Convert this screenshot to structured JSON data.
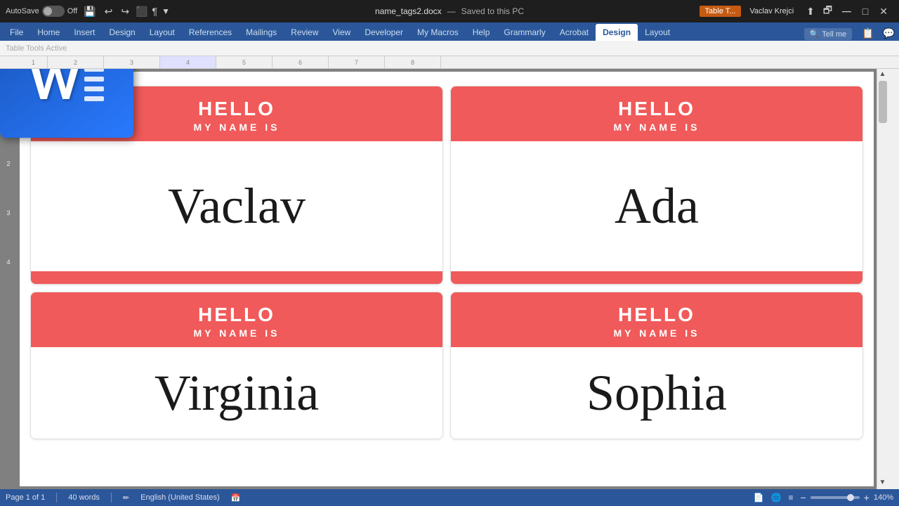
{
  "titlebar": {
    "autosave_label": "AutoSave",
    "autosave_state": "Off",
    "filename": "name_tags2.docx",
    "saved_state": "Saved to this PC",
    "context_tab": "Table T...",
    "username": "Vaclav Krejci",
    "tell_me": "Tell me"
  },
  "tabs": [
    {
      "label": "File",
      "active": false
    },
    {
      "label": "Home",
      "active": false
    },
    {
      "label": "Insert",
      "active": false
    },
    {
      "label": "Design",
      "active": false
    },
    {
      "label": "Layout",
      "active": false
    },
    {
      "label": "References",
      "active": false
    },
    {
      "label": "Mailings",
      "active": false
    },
    {
      "label": "Review",
      "active": false
    },
    {
      "label": "View",
      "active": false
    },
    {
      "label": "Developer",
      "active": false
    },
    {
      "label": "My Macros",
      "active": false
    },
    {
      "label": "Help",
      "active": false
    },
    {
      "label": "Grammarly",
      "active": false
    },
    {
      "label": "Acrobat",
      "active": false
    },
    {
      "label": "Design",
      "active": true,
      "context": false
    },
    {
      "label": "Layout",
      "active": false,
      "context": false
    }
  ],
  "nametags": [
    {
      "hello": "HELLO",
      "subtitle": "MY NAME IS",
      "name": "Vaclav"
    },
    {
      "hello": "HELLO",
      "subtitle": "MY NAME IS",
      "name": "Ada"
    },
    {
      "hello": "HELLO",
      "subtitle": "MY NAME IS",
      "name": "Virginia"
    },
    {
      "hello": "HELLO",
      "subtitle": "MY NAME IS",
      "name": "Sophia"
    }
  ],
  "statusbar": {
    "page": "Page 1 of 1",
    "words": "40 words",
    "language": "English (United States)",
    "zoom": "140%"
  },
  "colors": {
    "red": "#f05a5a",
    "ribbon_blue": "#2b579a"
  }
}
